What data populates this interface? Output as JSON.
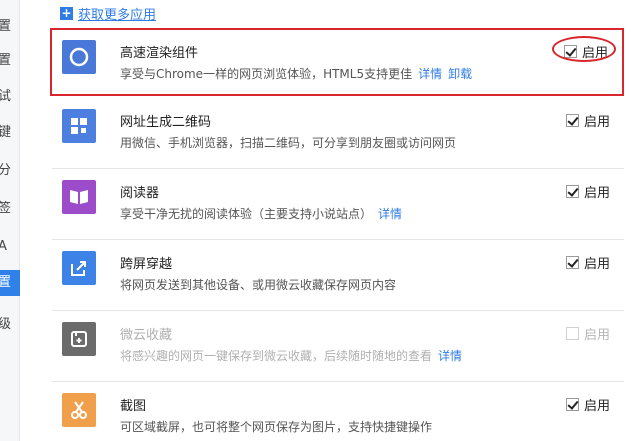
{
  "sidebar": {
    "items": [
      "置",
      "置",
      "试",
      "键",
      "分",
      "签",
      "A",
      "置",
      "级"
    ],
    "active_index": 7
  },
  "header": {
    "more_apps_label": "获取更多应用"
  },
  "apps": [
    {
      "name": "高速渲染组件",
      "desc": "享受与Chrome一样的网页浏览体验，HTML5支持更佳",
      "links": [
        "详情",
        "卸载"
      ],
      "toggle_label": "启用",
      "enabled": true,
      "icon": "chrome-render-icon",
      "color": "#4a78d8"
    },
    {
      "name": "网址生成二维码",
      "desc": "用微信、手机浏览器，扫描二维码，可分享到朋友圈或访问网页",
      "links": [],
      "toggle_label": "启用",
      "enabled": true,
      "icon": "qrcode-icon",
      "color": "#4c7fe0"
    },
    {
      "name": "阅读器",
      "desc": "享受干净无扰的阅读体验（主要支持小说站点）",
      "links": [
        "详情"
      ],
      "toggle_label": "启用",
      "enabled": true,
      "icon": "book-icon",
      "color": "#9c4cc9"
    },
    {
      "name": "跨屏穿越",
      "desc": "将网页发送到其他设备、或用微云收藏保存网页内容",
      "links": [],
      "toggle_label": "启用",
      "enabled": true,
      "icon": "share-icon",
      "color": "#3d82e6"
    },
    {
      "name": "微云收藏",
      "desc": "将感兴趣的网页一键保存到微云收藏，后续随时随地的查看",
      "links": [
        "详情"
      ],
      "toggle_label": "启用",
      "enabled": false,
      "icon": "bookmark-icon",
      "color": "#6b6b6b"
    },
    {
      "name": "截图",
      "desc": "可区域截屏，也可将整个网页保存为图片，支持快捷键操作",
      "links": [],
      "toggle_label": "启用",
      "enabled": true,
      "icon": "scissors-icon",
      "color": "#f0a04a"
    }
  ]
}
